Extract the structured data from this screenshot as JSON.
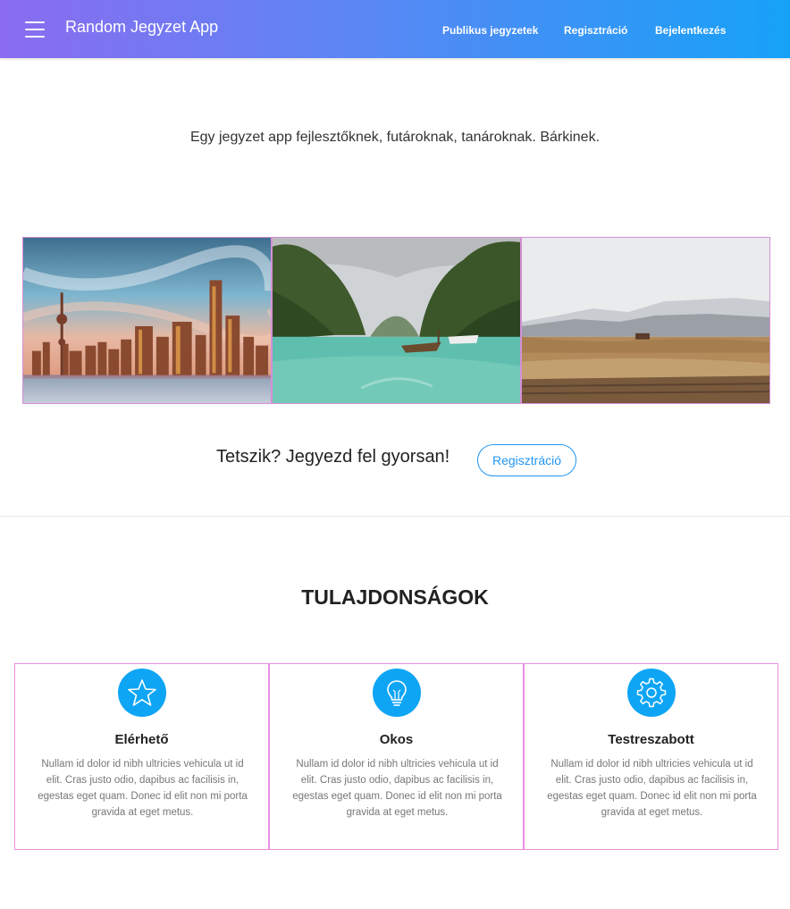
{
  "header": {
    "menu_icon": "hamburger-menu-icon",
    "brand": "Random Jegyzet App",
    "links": [
      "Publikus jegyzetek",
      "Regisztráció",
      "Bejelentkezés"
    ]
  },
  "hero": {
    "tagline": "Egy jegyzet app fejlesztőknek, futároknak, tanároknak. Bárkinek."
  },
  "gallery": {
    "images": [
      "city-skyline-image",
      "tropical-bay-image",
      "mountain-plains-image"
    ]
  },
  "cta": {
    "text": "Tetszik? Jegyezd fel gyorsan!",
    "button_label": "Regisztráció"
  },
  "features": {
    "title": "TULAJDONSÁGOK",
    "items": [
      {
        "icon": "star-icon",
        "title": "Elérhető",
        "desc": "Nullam id dolor id nibh ultricies vehicula ut id elit. Cras justo odio, dapibus ac facilisis in, egestas eget quam. Donec id elit non mi porta gravida at eget metus."
      },
      {
        "icon": "lightbulb-icon",
        "title": "Okos",
        "desc": "Nullam id dolor id nibh ultricies vehicula ut id elit. Cras justo odio, dapibus ac facilisis in, egestas eget quam. Donec id elit non mi porta gravida at eget metus."
      },
      {
        "icon": "gear-icon",
        "title": "Testreszabott",
        "desc": "Nullam id dolor id nibh ultricies vehicula ut id elit. Cras justo odio, dapibus ac facilisis in, egestas eget quam. Donec id elit non mi porta gravida at eget metus."
      }
    ]
  },
  "colors": {
    "header_gradient_start": "#8a6cf0",
    "header_gradient_end": "#16a2f8",
    "accent": "#2196f3",
    "icon_circle": "#0ea5f5",
    "card_border": "#e98fe3"
  }
}
